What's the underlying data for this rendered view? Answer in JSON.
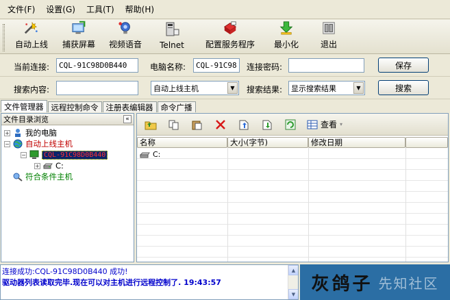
{
  "menu": {
    "items": [
      "文件(F)",
      "设置(G)",
      "工具(T)",
      "帮助(H)"
    ]
  },
  "toolbar": {
    "buttons": [
      {
        "label": "自动上线",
        "icon": "wizard-icon"
      },
      {
        "label": "捕获屏幕",
        "icon": "screen-capture-icon"
      },
      {
        "label": "视频语音",
        "icon": "video-voice-icon"
      },
      {
        "label": "Telnet",
        "icon": "telnet-computer-icon"
      },
      {
        "label": "配置服务程序",
        "icon": "config-service-icon"
      },
      {
        "label": "最小化",
        "icon": "minimize-arrow-icon"
      },
      {
        "label": "退出",
        "icon": "exit-icon"
      }
    ]
  },
  "connection": {
    "current_label": "当前连接:",
    "current_value": "CQL-91C98D0B440",
    "pcname_label": "电脑名称:",
    "pcname_value": "CQL-91C98D0",
    "password_label": "连接密码:",
    "password_value": "",
    "save_label": "保存"
  },
  "search": {
    "content_label": "搜索内容:",
    "content_value": "",
    "scope_value": "自动上线主机",
    "result_label": "搜索结果:",
    "result_value": "显示搜索结果",
    "search_label": "搜索"
  },
  "tabs": [
    "文件管理器",
    "远程控制命令",
    "注册表编辑器",
    "命令广播"
  ],
  "tree": {
    "header": "文件目录浏览",
    "nodes": {
      "my_computer": "我的电脑",
      "auto_online": "自动上线主机",
      "host": "CQL-91C98D0B440",
      "drive": "C:",
      "matched": "符合条件主机"
    }
  },
  "files": {
    "view_label": "查看",
    "columns": [
      "名称",
      "大小(字节)",
      "修改日期"
    ],
    "rows": [
      {
        "name": "C:"
      }
    ]
  },
  "log": {
    "line1": "连接成功:CQL-91C98D0B440 成功!",
    "line2": "驱动器列表读取完毕.现在可以对主机进行远程控制了. 19:43:57"
  },
  "brand": {
    "logo": "灰鸽子",
    "watermark": "先知社区"
  },
  "colors": {
    "window_bg": "#ECE9D8",
    "log_text": "#0000cc",
    "brand_bg": "#2b6ea4",
    "tree_green": "#008000",
    "tree_red": "#c00000"
  }
}
